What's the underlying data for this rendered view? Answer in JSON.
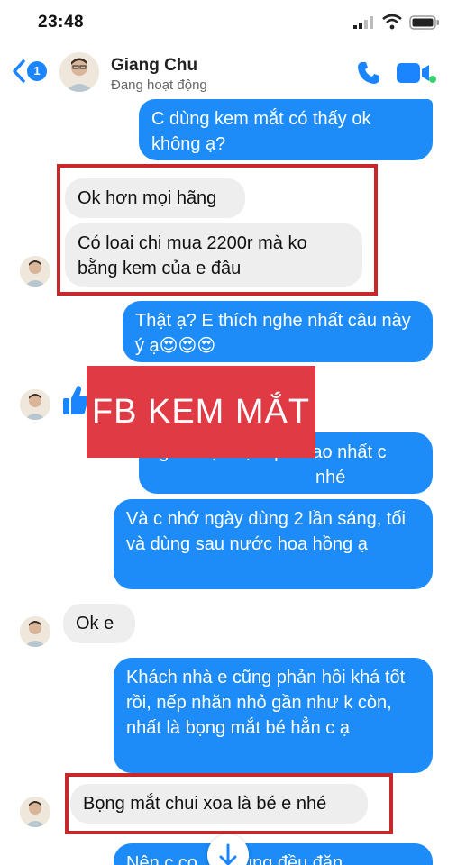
{
  "status": {
    "time": "23:48"
  },
  "header": {
    "back_count": "1",
    "name": "Giang Chu",
    "activity": "Đang hoạt động"
  },
  "messages": [
    {
      "dir": "out",
      "text": "C dùng kem mắt có thấy ok không ạ?"
    },
    {
      "dir": "in",
      "text": "Ok hơn mọi hãng"
    },
    {
      "dir": "in",
      "text": "Có loai chi mua 2200r mà ko bằng kem của e đâu"
    },
    {
      "dir": "out",
      "text": "Thật ạ? E thích nghe nhất câu này ý ạ😍😍😍"
    },
    {
      "dir": "out",
      "text": "ùng để đạt hiệu quả cao nhất c nhé"
    },
    {
      "dir": "out",
      "text": "Và c nhớ ngày dùng 2 lần sáng, tối và dùng sau nước hoa hồng ạ"
    },
    {
      "dir": "in",
      "text": "Ok e"
    },
    {
      "dir": "out",
      "text": "Khách nhà e cũng phản hồi khá tốt rồi, nếp nhăn nhỏ gần như k còn, nhất là bọng mắt bé hẳn c ạ"
    },
    {
      "dir": "in",
      "text": "Bọng mắt chui xoa là bé e nhé"
    },
    {
      "dir": "out",
      "text": "Nên c co       dùng đều đặn"
    }
  ],
  "overlay_label": "FB KEM MẮT",
  "colors": {
    "accent": "#1a85ff",
    "bubble_out": "#1d8cf8",
    "bubble_in": "#eeeeef",
    "highlight": "#c8282a",
    "label_bg": "#e03a44"
  }
}
